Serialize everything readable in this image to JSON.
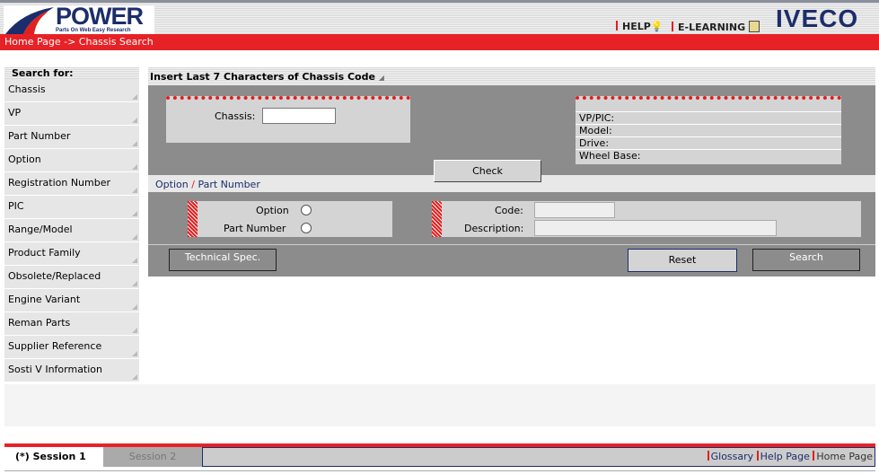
{
  "header": {
    "logo_text": "POWER",
    "logo_subtitle": "Parts On Web Easy Research",
    "help": "HELP",
    "elearning": "E-LEARNING",
    "brand": "IVECO"
  },
  "breadcrumb": "Home Page -> Chassis Search",
  "sidebar": {
    "heading": "Search for:",
    "items": [
      "Chassis",
      "VP",
      "Part Number",
      "Option",
      "Registration Number",
      "PIC",
      "Range/Model",
      "Product Family",
      "Obsolete/Replaced",
      "Engine Variant",
      "Reman Parts",
      "Supplier Reference",
      "Sosti V Information"
    ]
  },
  "main": {
    "title": "Insert Last 7 Characters of Chassis Code",
    "chassis_label": "Chassis:",
    "chassis_value": "",
    "check": "Check",
    "info": {
      "vp_pic": "VP/PIC:",
      "model": "Model:",
      "drive": "Drive:",
      "wheel_base": "Wheel Base:"
    },
    "subtitle_option": "Option",
    "subtitle_sep": "/",
    "subtitle_part": "Part Number",
    "radio_option": "Option",
    "radio_part": "Part Number",
    "code_label": "Code:",
    "description_label": "Description:",
    "technical_spec": "Technical Spec.",
    "reset": "Reset",
    "search": "Search"
  },
  "footer": {
    "session1": "(*) Session 1",
    "session2": "Session 2",
    "glossary": "Glossary",
    "help_page": "Help Page",
    "home_page": "Home Page"
  }
}
